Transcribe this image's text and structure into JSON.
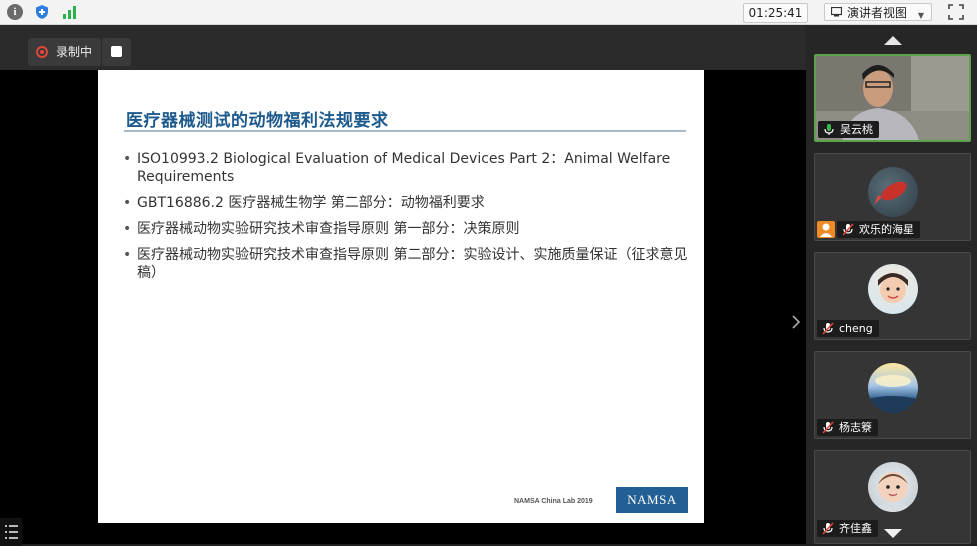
{
  "topbar": {
    "timer": "01:25:41",
    "presenter_view_label": "演讲者视图"
  },
  "recording": {
    "label": "录制中"
  },
  "slide": {
    "title": "医疗器械测试的动物福利法规要求",
    "bullets": [
      "ISO10993.2 Biological Evaluation of Medical Devices Part 2：Animal Welfare Requirements",
      "GBT16886.2 医疗器械生物学 第二部分：动物福利要求",
      "医疗器械动物实验研究技术审查指导原则 第一部分：决策原则",
      "医疗器械动物实验研究技术审查指导原则 第二部分：实验设计、实施质量保证（征求意见稿）"
    ],
    "footer": "NAMSA China Lab 2019",
    "logo_text": "NAMSA"
  },
  "participants": [
    {
      "name": "吴云桃",
      "mic": "on",
      "video": true
    },
    {
      "name": "欢乐的海星",
      "mic": "muted"
    },
    {
      "name": "cheng",
      "mic": "muted"
    },
    {
      "name": "杨志簝",
      "mic": "muted"
    },
    {
      "name": "齐佳鑫",
      "mic": "muted"
    }
  ],
  "colors": {
    "slide_title": "#1d5a8e",
    "logo_bg": "#215f95",
    "active_speaker_border": "#5ca44c",
    "muted_mic": "#e0453a"
  }
}
